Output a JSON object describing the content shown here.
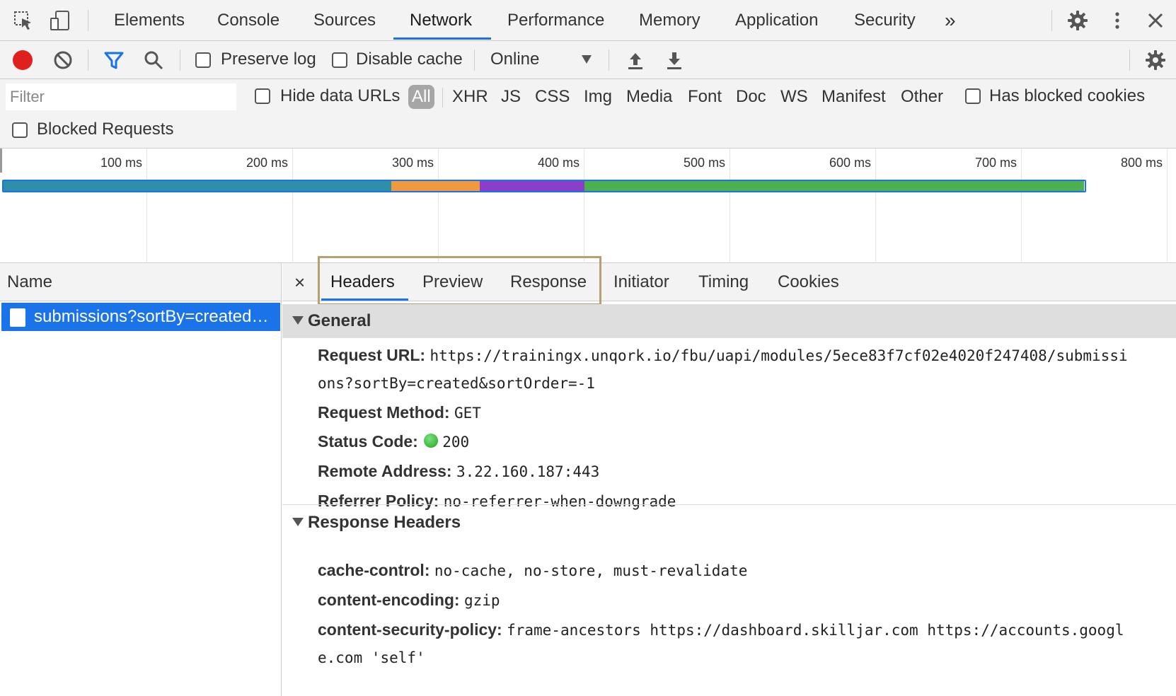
{
  "main_tabs": {
    "elements": "Elements",
    "console": "Console",
    "sources": "Sources",
    "network": "Network",
    "performance": "Performance",
    "memory": "Memory",
    "application": "Application",
    "security": "Security",
    "more": "»"
  },
  "toolbar": {
    "preserve_log": "Preserve log",
    "disable_cache": "Disable cache",
    "throttling": "Online"
  },
  "filter": {
    "placeholder": "Filter",
    "hide_data_urls": "Hide data URLs",
    "types": {
      "all": "All",
      "xhr": "XHR",
      "js": "JS",
      "css": "CSS",
      "img": "Img",
      "media": "Media",
      "font": "Font",
      "doc": "Doc",
      "ws": "WS",
      "manifest": "Manifest",
      "other": "Other"
    },
    "has_blocked_cookies": "Has blocked cookies",
    "blocked_requests": "Blocked Requests"
  },
  "timeline": {
    "ticks": [
      "100 ms",
      "200 ms",
      "300 ms",
      "400 ms",
      "500 ms",
      "600 ms",
      "700 ms",
      "800 ms"
    ],
    "colors": {
      "waiting": "#2f8fa8",
      "stalled": "#f0993e",
      "ssl": "#8a3fc8",
      "download": "#4caf50",
      "outline": "#1a73e8"
    }
  },
  "request_list": {
    "column_name": "Name",
    "rows": [
      {
        "name": "submissions?sortBy=created…"
      }
    ]
  },
  "detail_tabs": {
    "headers": "Headers",
    "preview": "Preview",
    "response": "Response",
    "initiator": "Initiator",
    "timing": "Timing",
    "cookies": "Cookies"
  },
  "general": {
    "title": "General",
    "request_url_key": "Request URL:",
    "request_url_line1": "https://trainingx.unqork.io/fbu/uapi/modules/5ece83f7cf02e4020f247408/submissi",
    "request_url_line2": "ons?sortBy=created&sortOrder=-1",
    "request_method_key": "Request Method:",
    "request_method_val": "GET",
    "status_code_key": "Status Code:",
    "status_code_val": "200",
    "remote_address_key": "Remote Address:",
    "remote_address_val": "3.22.160.187:443",
    "referrer_policy_key": "Referrer Policy:",
    "referrer_policy_val": "no-referrer-when-downgrade"
  },
  "response_headers": {
    "title": "Response Headers",
    "cache_control_key": "cache-control:",
    "cache_control_val": "no-cache, no-store, must-revalidate",
    "content_encoding_key": "content-encoding:",
    "content_encoding_val": "gzip",
    "csp_key": "content-security-policy:",
    "csp_val_line1": "frame-ancestors https://dashboard.skilljar.com https://accounts.googl",
    "csp_val_line2": "e.com 'self'"
  },
  "icons": {
    "inspect": "inspect-element-icon",
    "device": "device-toolbar-icon",
    "settings": "gear-icon",
    "menu": "kebab-menu-icon",
    "close": "close-icon",
    "record": "record-icon",
    "clear": "clear-icon",
    "filter": "filter-icon",
    "search": "search-icon",
    "import": "import-har-icon",
    "export": "export-har-icon",
    "dropdown": "dropdown-arrow-icon"
  }
}
